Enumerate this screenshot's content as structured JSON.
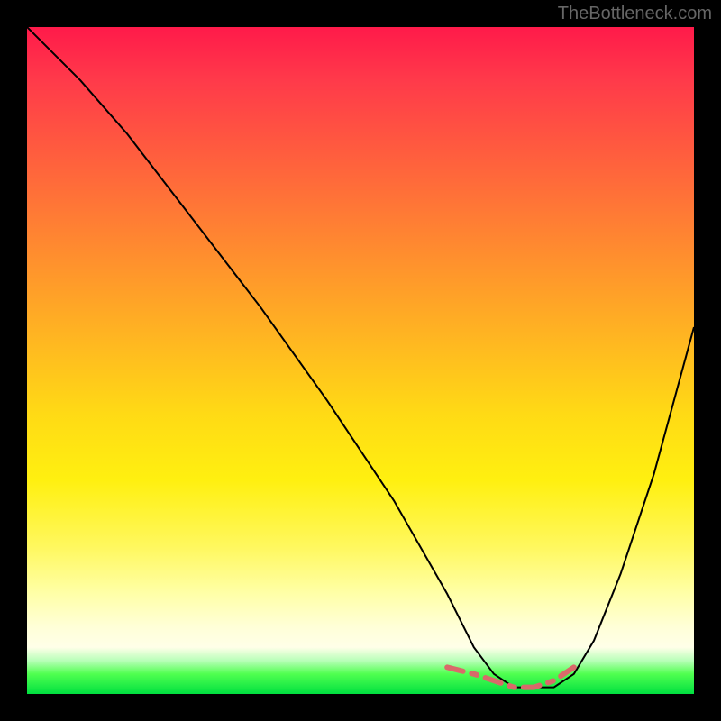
{
  "watermark": "TheBottleneck.com",
  "chart_data": {
    "type": "line",
    "title": "",
    "xlabel": "",
    "ylabel": "",
    "xlim": [
      0,
      100
    ],
    "ylim": [
      0,
      100
    ],
    "gradient_stops": [
      {
        "pos": 0,
        "hex": "#ff1a4a"
      },
      {
        "pos": 8,
        "hex": "#ff3a4a"
      },
      {
        "pos": 18,
        "hex": "#ff5a3f"
      },
      {
        "pos": 28,
        "hex": "#ff7a35"
      },
      {
        "pos": 38,
        "hex": "#ff9a2a"
      },
      {
        "pos": 48,
        "hex": "#ffba20"
      },
      {
        "pos": 58,
        "hex": "#ffda15"
      },
      {
        "pos": 68,
        "hex": "#fff010"
      },
      {
        "pos": 78,
        "hex": "#fff85f"
      },
      {
        "pos": 85,
        "hex": "#ffffa8"
      },
      {
        "pos": 90,
        "hex": "#ffffd8"
      },
      {
        "pos": 93,
        "hex": "#ffffe8"
      },
      {
        "pos": 95,
        "hex": "#b8ffb8"
      },
      {
        "pos": 97,
        "hex": "#50ff50"
      },
      {
        "pos": 100,
        "hex": "#00e040"
      }
    ],
    "series": [
      {
        "name": "bottleneck-curve",
        "color": "#000000",
        "width": 2,
        "x": [
          0,
          3,
          8,
          15,
          25,
          35,
          45,
          55,
          63,
          67,
          70,
          73,
          76,
          79,
          82,
          85,
          89,
          94,
          100
        ],
        "y": [
          100,
          97,
          92,
          84,
          71,
          58,
          44,
          29,
          15,
          7,
          3,
          1,
          1,
          1,
          3,
          8,
          18,
          33,
          55
        ]
      },
      {
        "name": "optimal-range-marker",
        "color": "#d96a6a",
        "width": 6,
        "style": "dashed",
        "x": [
          63,
          67,
          70,
          73,
          76,
          79,
          82
        ],
        "y": [
          4,
          3,
          2,
          1,
          1,
          2,
          4
        ]
      }
    ],
    "y_axis_inverted_note": "y=0 at bottom (green/best), y=100 at top (red/worst)"
  }
}
